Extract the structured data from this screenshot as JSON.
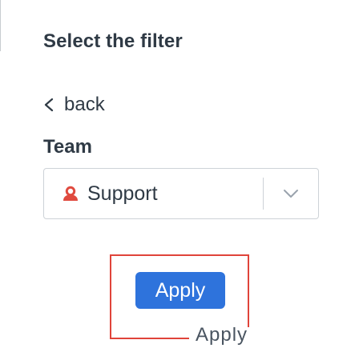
{
  "filter_panel": {
    "title": "Select the filter",
    "back_label": "back",
    "team_label": "Team",
    "team_select": {
      "selected_value": "Support",
      "icon": "team-icon"
    },
    "apply_button_label": "Apply",
    "apply_tooltip_label": "Apply"
  },
  "colors": {
    "text": "#2f3a45",
    "primary_button": "#2e73dc",
    "highlight_outline": "#e0443a",
    "border": "#cdd2d7",
    "team_icon": "#e04a3f"
  }
}
